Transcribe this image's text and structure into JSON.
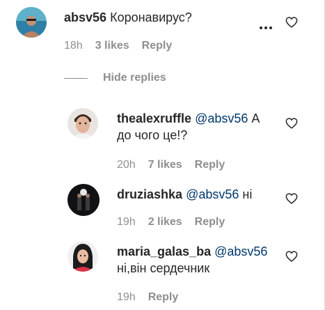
{
  "root_comment": {
    "username": "absv56",
    "text": "Коронавирус?",
    "time": "18h",
    "likes": "3 likes",
    "reply_label": "Reply",
    "more_icon": "more-horizontal-icon",
    "like_icon": "heart-outline-icon"
  },
  "toggle_replies": {
    "label": "Hide replies"
  },
  "replies": [
    {
      "username": "thealexruffle",
      "mention": "@absv56",
      "text_line1": "А",
      "text_line2": "до чого це!?",
      "time": "20h",
      "likes": "7 likes",
      "reply_label": "Reply"
    },
    {
      "username": "druziashka",
      "mention": "@absv56",
      "text_line1": "ні",
      "time": "19h",
      "likes": "2 likes",
      "reply_label": "Reply"
    },
    {
      "username": "maria_galas_ba",
      "mention": "@absv56",
      "text_line2": "ні,він сердечник",
      "time": "19h",
      "reply_label": "Reply"
    }
  ],
  "colors": {
    "text": "#262626",
    "secondary": "#8e8e8e",
    "mention": "#00376b",
    "border": "#dbdbdb"
  }
}
